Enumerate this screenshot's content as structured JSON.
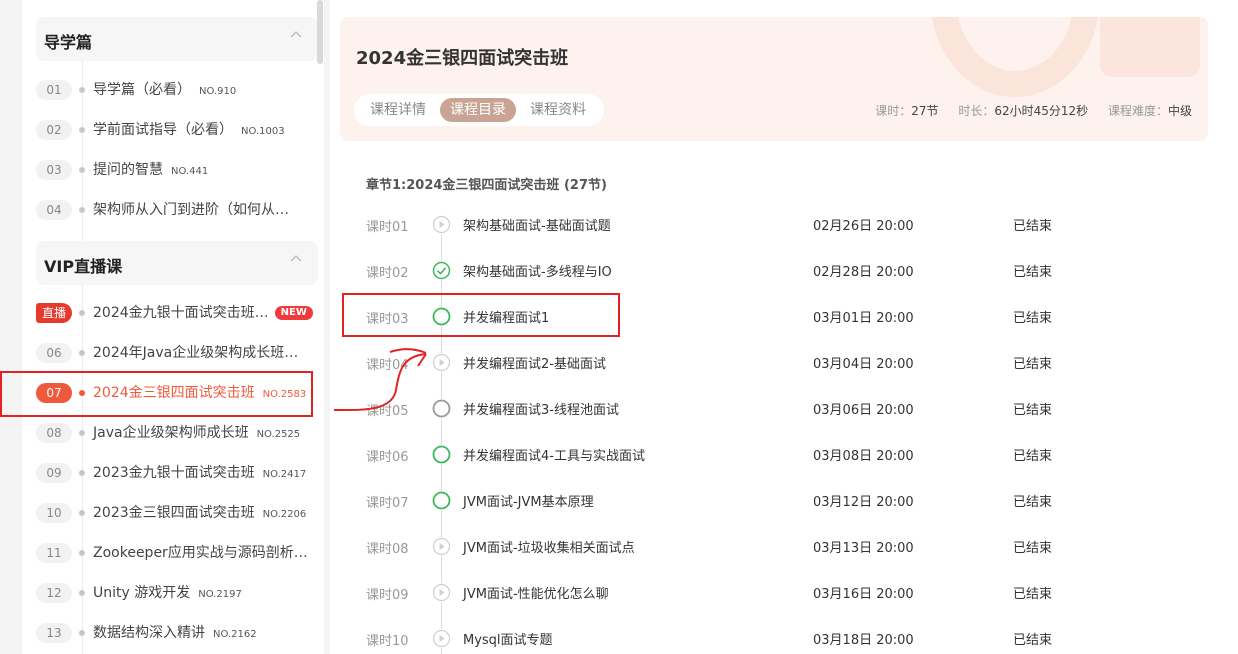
{
  "sidebar": {
    "guide_section": {
      "title": "导学篇"
    },
    "guide_items": [
      {
        "num": "01",
        "label": "导学篇（必看）",
        "no": "NO.910"
      },
      {
        "num": "02",
        "label": "学前面试指导（必看）",
        "no": "NO.1003"
      },
      {
        "num": "03",
        "label": "提问的智慧",
        "no": "NO.441"
      },
      {
        "num": "04",
        "label": "架构师从入门到进阶（如何从…",
        "no": ""
      }
    ],
    "vip_section": {
      "title": "VIP直播课"
    },
    "vip_items": [
      {
        "num": "直播",
        "label": "2024金九银十面试突击班…",
        "no": "",
        "badge": "NEW"
      },
      {
        "num": "06",
        "label": "2024年Java企业级架构成长班…",
        "no": ""
      },
      {
        "num": "07",
        "label": "2024金三银四面试突击班",
        "no": "NO.2583"
      },
      {
        "num": "08",
        "label": "Java企业级架构师成长班",
        "no": "NO.2525"
      },
      {
        "num": "09",
        "label": "2023金九银十面试突击班",
        "no": "NO.2417"
      },
      {
        "num": "10",
        "label": "2023金三银四面试突击班",
        "no": "NO.2206"
      },
      {
        "num": "11",
        "label": "Zookeeper应用实战与源码剖析…",
        "no": ""
      },
      {
        "num": "12",
        "label": "Unity 游戏开发",
        "no": "NO.2197"
      },
      {
        "num": "13",
        "label": "数据结构深入精讲",
        "no": "NO.2162"
      }
    ]
  },
  "course": {
    "title": "2024金三银四面试突击班",
    "tabs": [
      "课程详情",
      "课程目录",
      "课程资料"
    ],
    "meta": {
      "lessons_label": "课时：",
      "lessons_value": "27节",
      "duration_label": "时长：",
      "duration_value": "62小时45分12秒",
      "difficulty_label": "课程难度：",
      "difficulty_value": "中级"
    }
  },
  "chapter": {
    "title": "章节1:2024金三银四面试突击班 (27节)"
  },
  "lessons": [
    {
      "lesson": "课时01",
      "name": "架构基础面试-基础面试题",
      "time": "02月26日 20:00",
      "status": "已结束",
      "icon": "play-icon"
    },
    {
      "lesson": "课时02",
      "name": "架构基础面试-多线程与IO",
      "time": "02月28日 20:00",
      "status": "已结束",
      "icon": "check-circle-icon"
    },
    {
      "lesson": "课时03",
      "name": "并发编程面试1",
      "time": "03月01日 20:00",
      "status": "已结束",
      "icon": "green-circle-icon"
    },
    {
      "lesson": "课时04",
      "name": "并发编程面试2-基础面试",
      "time": "03月04日 20:00",
      "status": "已结束",
      "icon": "play-icon"
    },
    {
      "lesson": "课时05",
      "name": "并发编程面试3-线程池面试",
      "time": "03月06日 20:00",
      "status": "已结束",
      "icon": "gray-circle-icon"
    },
    {
      "lesson": "课时06",
      "name": "并发编程面试4-工具与实战面试",
      "time": "03月08日 20:00",
      "status": "已结束",
      "icon": "green-circle-icon"
    },
    {
      "lesson": "课时07",
      "name": "JVM面试-JVM基本原理",
      "time": "03月12日 20:00",
      "status": "已结束",
      "icon": "green-circle-icon"
    },
    {
      "lesson": "课时08",
      "name": "JVM面试-垃圾收集相关面试点",
      "time": "03月13日 20:00",
      "status": "已结束",
      "icon": "play-icon"
    },
    {
      "lesson": "课时09",
      "name": "JVM面试-性能优化怎么聊",
      "time": "03月16日 20:00",
      "status": "已结束",
      "icon": "play-icon"
    },
    {
      "lesson": "课时10",
      "name": "Mysql面试专题",
      "time": "03月18日 20:00",
      "status": "已结束",
      "icon": "play-icon"
    }
  ],
  "colors": {
    "accent": "#ef5a3c",
    "green": "#3cb85c",
    "annotation": "#e32222"
  }
}
